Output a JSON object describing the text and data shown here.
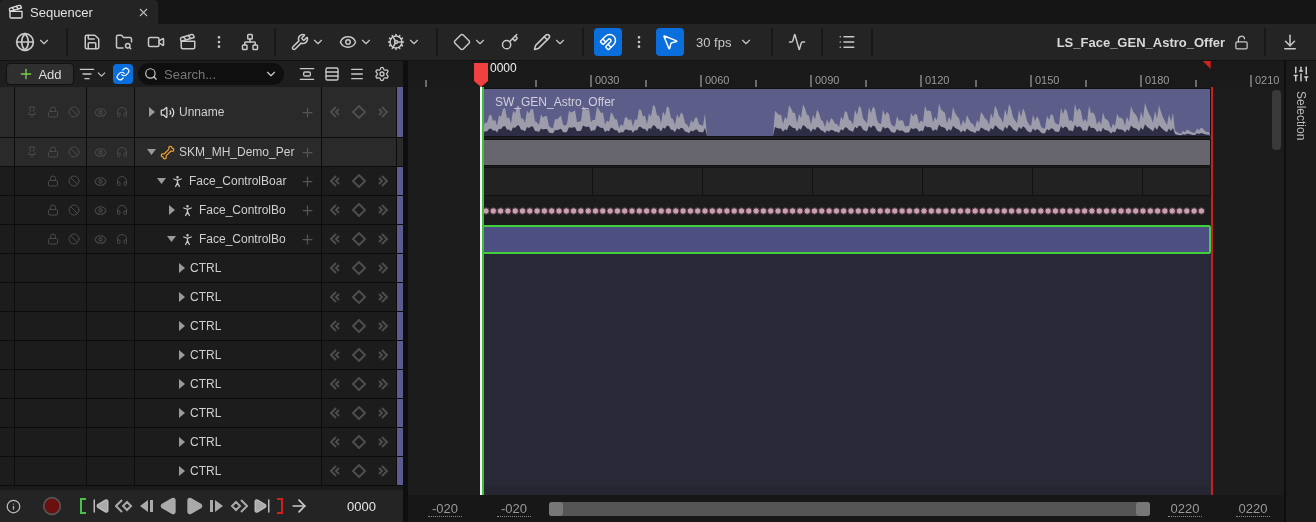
{
  "tab": {
    "title": "Sequencer"
  },
  "toolbar": {
    "toggles": [
      {
        "kind": "snap",
        "on": true
      },
      {
        "kind": "scrub",
        "on": true
      }
    ],
    "fps": "30 fps",
    "sequence_name": "LS_Face_GEN_Astro_Offer",
    "locked": false
  },
  "outliner": {
    "add_label": "Add",
    "link_on": true,
    "search": {
      "placeholder": "Search..."
    }
  },
  "tracks": [
    {
      "name": "Unname",
      "kind": "audio",
      "expanded": false,
      "selected": false,
      "section": "SW_GEN_Astro_Offer"
    },
    {
      "name": "SKM_MH_Demo_Per",
      "kind": "skeletal",
      "expanded": true,
      "selected": false,
      "children": [
        {
          "name": "Face_ControlBoar",
          "kind": "rig",
          "expanded": true,
          "selected": false,
          "children": [
            {
              "name": "Face_ControlBo",
              "kind": "rig",
              "expanded": false,
              "selected": false
            },
            {
              "name": "Face_ControlBo",
              "kind": "rig",
              "expanded": true,
              "selected": true,
              "children": [
                {
                  "name": "CTRL",
                  "kind": "control",
                  "expanded": false,
                  "selected": false
                },
                {
                  "name": "CTRL",
                  "kind": "control",
                  "expanded": false,
                  "selected": false
                },
                {
                  "name": "CTRL",
                  "kind": "control",
                  "expanded": false,
                  "selected": false
                },
                {
                  "name": "CTRL",
                  "kind": "control",
                  "expanded": false,
                  "selected": false
                },
                {
                  "name": "CTRL",
                  "kind": "control",
                  "expanded": false,
                  "selected": false
                },
                {
                  "name": "CTRL",
                  "kind": "control",
                  "expanded": false,
                  "selected": false
                },
                {
                  "name": "CTRL",
                  "kind": "control",
                  "expanded": false,
                  "selected": false
                },
                {
                  "name": "CTRL",
                  "kind": "control",
                  "expanded": false,
                  "selected": false
                }
              ]
            }
          ]
        }
      ]
    }
  ],
  "ruler": {
    "current_frame": "0000",
    "labels": [
      "0030",
      "0060",
      "0090",
      "0120",
      "0150",
      "0180",
      "0210"
    ]
  },
  "transport": {
    "frame": "0000"
  },
  "range": {
    "view_start": "-020",
    "play_start": "-020",
    "play_end": "0220",
    "view_end": "0220"
  },
  "side_panel": {
    "label": "Selection"
  }
}
